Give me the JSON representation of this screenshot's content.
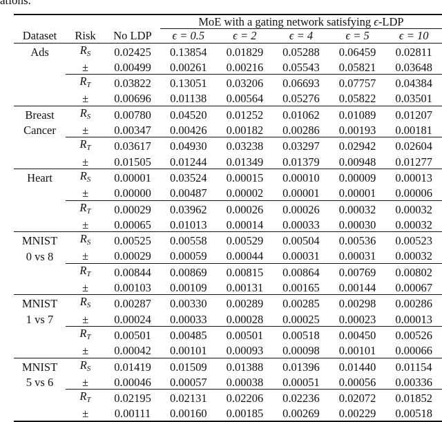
{
  "caption_tail": "ations.",
  "table": {
    "header": {
      "group_label_prefix": "MoE with a gating network satisfying ",
      "group_label_eps": "ϵ",
      "group_label_suffix": "-LDP",
      "dataset": "Dataset",
      "risk": "Risk",
      "no_ldp": "No LDP",
      "epsilons": [
        "ϵ = 0.5",
        "ϵ = 2",
        "ϵ = 4",
        "ϵ = 5",
        "ϵ = 10"
      ]
    },
    "risk_labels": {
      "source": {
        "base": "R",
        "sub": "S"
      },
      "target": {
        "base": "R",
        "sub": "T"
      },
      "pm": "±"
    },
    "groups": [
      {
        "dataset_lines": [
          "Ads",
          ""
        ],
        "rows": [
          {
            "risk": "source",
            "values": [
              "0.02425",
              "0.13854",
              "0.01829",
              "0.05288",
              "0.06459",
              "0.02811"
            ],
            "bold": []
          },
          {
            "risk": "pm",
            "values": [
              "0.00499",
              "0.00261",
              "0.00216",
              "0.05543",
              "0.05821",
              "0.03648"
            ],
            "bold": []
          },
          {
            "risk": "target",
            "values": [
              "0.03822",
              "0.13051",
              "0.03206",
              "0.06693",
              "0.07757",
              "0.04384"
            ],
            "bold": [
              2
            ]
          },
          {
            "risk": "pm",
            "values": [
              "0.00696",
              "0.01138",
              "0.00564",
              "0.05276",
              "0.05822",
              "0.03501"
            ],
            "bold": [
              2
            ]
          }
        ]
      },
      {
        "dataset_lines": [
          "Breast",
          "Cancer"
        ],
        "rows": [
          {
            "risk": "source",
            "values": [
              "0.00780",
              "0.04520",
              "0.01252",
              "0.01062",
              "0.01089",
              "0.01207"
            ],
            "bold": []
          },
          {
            "risk": "pm",
            "values": [
              "0.00347",
              "0.00426",
              "0.00182",
              "0.00286",
              "0.00193",
              "0.00181"
            ],
            "bold": []
          },
          {
            "risk": "target",
            "values": [
              "0.03617",
              "0.04930",
              "0.03238",
              "0.03297",
              "0.02942",
              "0.02604"
            ],
            "bold": [
              5
            ]
          },
          {
            "risk": "pm",
            "values": [
              "0.01505",
              "0.01244",
              "0.01349",
              "0.01379",
              "0.00948",
              "0.01277"
            ],
            "bold": [
              5
            ]
          }
        ]
      },
      {
        "dataset_lines": [
          "Heart",
          ""
        ],
        "rows": [
          {
            "risk": "source",
            "values": [
              "0.00001",
              "0.03524",
              "0.00015",
              "0.00010",
              "0.00009",
              "0.00013"
            ],
            "bold": []
          },
          {
            "risk": "pm",
            "values": [
              "0.00000",
              "0.00487",
              "0.00002",
              "0.00001",
              "0.00001",
              "0.00006"
            ],
            "bold": []
          },
          {
            "risk": "target",
            "values": [
              "0.00029",
              "0.03962",
              "0.00026",
              "0.00026",
              "0.00032",
              "0.00032"
            ],
            "bold": [
              2
            ]
          },
          {
            "risk": "pm",
            "values": [
              "0.00065",
              "0.01013",
              "0.00014",
              "0.00033",
              "0.00030",
              "0.00032"
            ],
            "bold": [
              2
            ]
          }
        ]
      },
      {
        "dataset_lines": [
          "MNIST",
          "0 vs 8"
        ],
        "rows": [
          {
            "risk": "source",
            "values": [
              "0.00525",
              "0.00558",
              "0.00529",
              "0.00504",
              "0.00536",
              "0.00523"
            ],
            "bold": []
          },
          {
            "risk": "pm",
            "values": [
              "0.00029",
              "0.00059",
              "0.00044",
              "0.00031",
              "0.00031",
              "0.00032"
            ],
            "bold": []
          },
          {
            "risk": "target",
            "values": [
              "0.00844",
              "0.00869",
              "0.00815",
              "0.00864",
              "0.00769",
              "0.00802"
            ],
            "bold": [
              4
            ]
          },
          {
            "risk": "pm",
            "values": [
              "0.00103",
              "0.00109",
              "0.00131",
              "0.00165",
              "0.00144",
              "0.00067"
            ],
            "bold": [
              4
            ]
          }
        ]
      },
      {
        "dataset_lines": [
          "MNIST",
          "1 vs 7"
        ],
        "rows": [
          {
            "risk": "source",
            "values": [
              "0.00287",
              "0.00330",
              "0.00289",
              "0.00285",
              "0.00298",
              "0.00286"
            ],
            "bold": []
          },
          {
            "risk": "pm",
            "values": [
              "0.00024",
              "0.00033",
              "0.00028",
              "0.00025",
              "0.00023",
              "0.00013"
            ],
            "bold": []
          },
          {
            "risk": "target",
            "values": [
              "0.00501",
              "0.00485",
              "0.00501",
              "0.00518",
              "0.00450",
              "0.00526"
            ],
            "bold": [
              4
            ]
          },
          {
            "risk": "pm",
            "values": [
              "0.00042",
              "0.00101",
              "0.00093",
              "0.00098",
              "0.00101",
              "0.00066"
            ],
            "bold": [
              4
            ]
          }
        ]
      },
      {
        "dataset_lines": [
          "MNIST",
          "5 vs 6"
        ],
        "rows": [
          {
            "risk": "source",
            "values": [
              "0.01419",
              "0.01509",
              "0.01388",
              "0.01396",
              "0.01440",
              "0.01154"
            ],
            "bold": []
          },
          {
            "risk": "pm",
            "values": [
              "0.00046",
              "0.00057",
              "0.00038",
              "0.00051",
              "0.00056",
              "0.00336"
            ],
            "bold": []
          },
          {
            "risk": "target",
            "values": [
              "0.02195",
              "0.02131",
              "0.02206",
              "0.02236",
              "0.02072",
              "0.01852"
            ],
            "bold": [
              5
            ]
          },
          {
            "risk": "pm",
            "values": [
              "0.00111",
              "0.00160",
              "0.00185",
              "0.00269",
              "0.00229",
              "0.00518"
            ],
            "bold": [
              5
            ]
          }
        ]
      }
    ]
  }
}
